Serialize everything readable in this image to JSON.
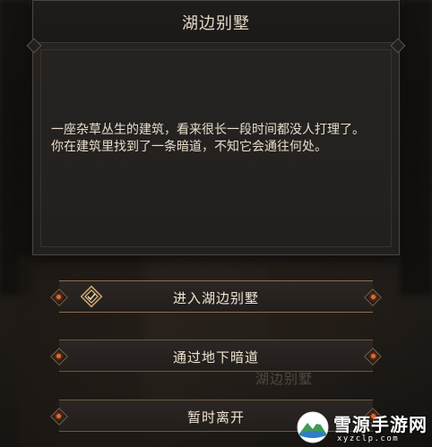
{
  "dialog": {
    "title": "湖边别墅",
    "body_lines": [
      "一座杂草丛生的建筑，看来很长一段时间都没人打理了。",
      "你在建筑里找到了一条暗道，不知它会通往何处。"
    ]
  },
  "options": [
    {
      "label": "进入湖边别墅",
      "icon": "select-diamond-icon"
    },
    {
      "label": "通过地下暗道"
    },
    {
      "label": "暂时离开"
    }
  ],
  "background": {
    "faded_text": "湖边别墅"
  },
  "watermark": {
    "name": "雪源手游网",
    "url": "xyzclp.com",
    "icon": "mountain-logo-icon"
  },
  "colors": {
    "accent_orange": "#e06a2a",
    "text_light": "#e8ddcb",
    "panel_bg": "#22201e",
    "border_bronze": "#6b5842"
  }
}
